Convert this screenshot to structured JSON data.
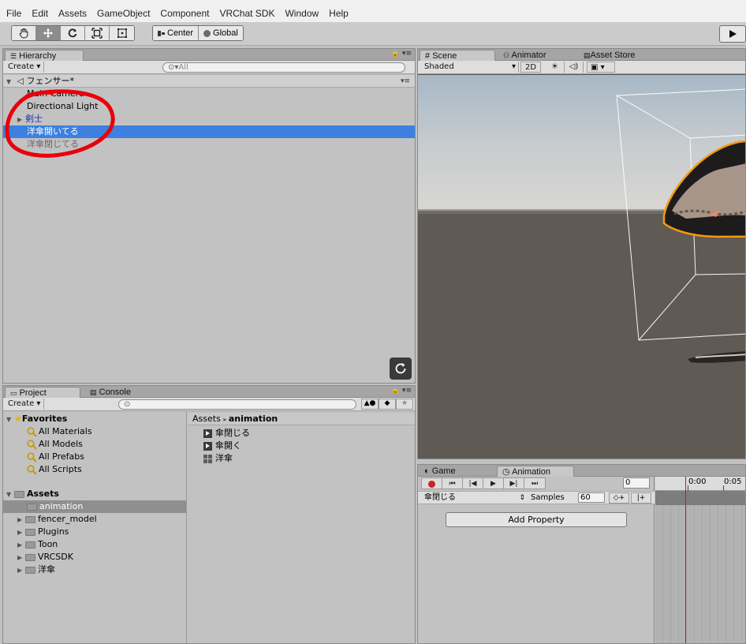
{
  "menu": [
    "File",
    "Edit",
    "Assets",
    "GameObject",
    "Component",
    "VRChat SDK",
    "Window",
    "Help"
  ],
  "toolbar": {
    "tools": [
      "hand-icon",
      "move-icon",
      "rotate-icon",
      "scale-icon",
      "rect-icon"
    ],
    "pivot_label": "Center",
    "space_label": "Global"
  },
  "hierarchy": {
    "tab_label": "Hierarchy",
    "create_label": "Create",
    "search_placeholder": "All",
    "scene_name": "フェンサー*",
    "items": [
      {
        "label": "Main Camera",
        "state": "normal",
        "expandable": false
      },
      {
        "label": "Directional Light",
        "state": "normal",
        "expandable": false
      },
      {
        "label": "剣士",
        "state": "prefab",
        "expandable": true
      },
      {
        "label": "洋傘開いてる",
        "state": "selected",
        "expandable": false
      },
      {
        "label": "洋傘閉じてる",
        "state": "inactive",
        "expandable": false
      }
    ]
  },
  "scene": {
    "tabs": [
      "Scene",
      "Animator",
      "Asset Store"
    ],
    "shading_mode": "Shaded",
    "mode_2d": "2D"
  },
  "project": {
    "tabs": [
      "Project",
      "Console"
    ],
    "create_label": "Create",
    "favorites_label": "Favorites",
    "favorites": [
      "All Materials",
      "All Models",
      "All Prefabs",
      "All Scripts"
    ],
    "assets_label": "Assets",
    "folders": [
      {
        "label": "animation",
        "selected": true,
        "expandable": false
      },
      {
        "label": "fencer_model",
        "selected": false,
        "expandable": true
      },
      {
        "label": "Plugins",
        "selected": false,
        "expandable": true
      },
      {
        "label": "Toon",
        "selected": false,
        "expandable": true
      },
      {
        "label": "VRCSDK",
        "selected": false,
        "expandable": true
      },
      {
        "label": "洋傘",
        "selected": false,
        "expandable": true
      }
    ],
    "breadcrumb_root": "Assets",
    "breadcrumb_current": "animation",
    "files": [
      {
        "label": "傘閉じる",
        "kind": "clip"
      },
      {
        "label": "傘開く",
        "kind": "clip"
      },
      {
        "label": "洋傘",
        "kind": "controller"
      }
    ]
  },
  "animation": {
    "tabs": [
      "Game",
      "Animation"
    ],
    "frame_value": "0",
    "clip_name": "傘閉じる",
    "samples_label": "Samples",
    "samples_value": "60",
    "add_property_label": "Add Property",
    "time_ticks": [
      "0:00",
      "0:05"
    ]
  },
  "colors": {
    "selection": "#3d80df",
    "annotation_circle": "#e8000a",
    "record": "#d0231e"
  }
}
